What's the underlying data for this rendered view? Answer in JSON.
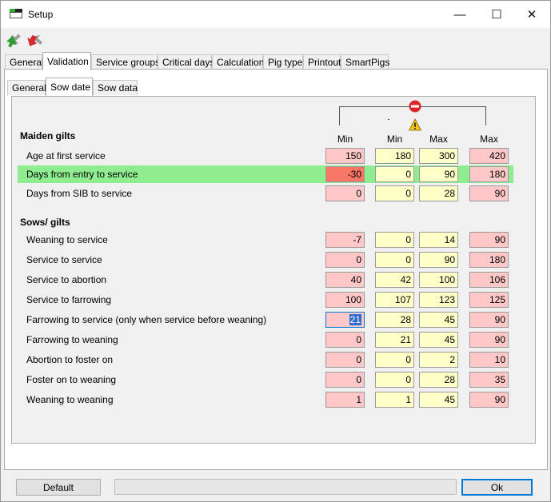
{
  "window": {
    "title": "Setup",
    "minimize": "—",
    "maximize": "☐",
    "close": "✕"
  },
  "toolbar": {
    "icons": [
      "green-refresh-icon",
      "red-arrows-icon"
    ]
  },
  "tabs_main": [
    "General",
    "Validation",
    "Service groups",
    "Critical days",
    "Calculation",
    "Pig type",
    "Printout",
    "SmartPigs"
  ],
  "tabs_main_active": "Validation",
  "tabs_sub": [
    "General",
    "Sow date",
    "Sow data"
  ],
  "tabs_sub_active": "Sow date",
  "column_headers": [
    "Min",
    "Min",
    "Max",
    "Max"
  ],
  "sections": {
    "maiden_gilts": "Maiden gilts",
    "sows_gilts": "Sows/ gilts"
  },
  "rows_maiden": [
    {
      "label": "Age at first service",
      "values": [
        "150",
        "180",
        "300",
        "420"
      ]
    },
    {
      "label": "Days from entry to service",
      "values": [
        "-30",
        "0",
        "90",
        "180"
      ],
      "highlighted": true
    },
    {
      "label": "Days from SIB to service",
      "values": [
        "0",
        "0",
        "28",
        "90"
      ]
    }
  ],
  "rows_sows": [
    {
      "label": "Weaning to service",
      "values": [
        "-7",
        "0",
        "14",
        "90"
      ]
    },
    {
      "label": "Service to service",
      "values": [
        "0",
        "0",
        "90",
        "180"
      ]
    },
    {
      "label": "Service to abortion",
      "values": [
        "40",
        "42",
        "100",
        "106"
      ]
    },
    {
      "label": "Service to farrowing",
      "values": [
        "100",
        "107",
        "123",
        "125"
      ]
    },
    {
      "label": "Farrowing to service (only when service before weaning)",
      "values": [
        "21",
        "28",
        "45",
        "90"
      ],
      "selected": true
    },
    {
      "label": "Farrowing to weaning",
      "values": [
        "0",
        "21",
        "45",
        "90"
      ]
    },
    {
      "label": "Abortion to foster on",
      "values": [
        "0",
        "0",
        "2",
        "10"
      ]
    },
    {
      "label": "Foster on to weaning",
      "values": [
        "0",
        "0",
        "28",
        "35"
      ]
    },
    {
      "label": "Weaning to weaning",
      "values": [
        "1",
        "1",
        "45",
        "90"
      ]
    }
  ],
  "buttons": {
    "default": "Default",
    "ok": "Ok"
  },
  "colors": {
    "hard_limit": "#ffc8c8",
    "soft_limit": "#ffffc8",
    "row_highlight": "#8fed8f",
    "error_cell": "#f87666"
  },
  "header_icons": [
    "stop-error-icon",
    "warning-icon"
  ]
}
